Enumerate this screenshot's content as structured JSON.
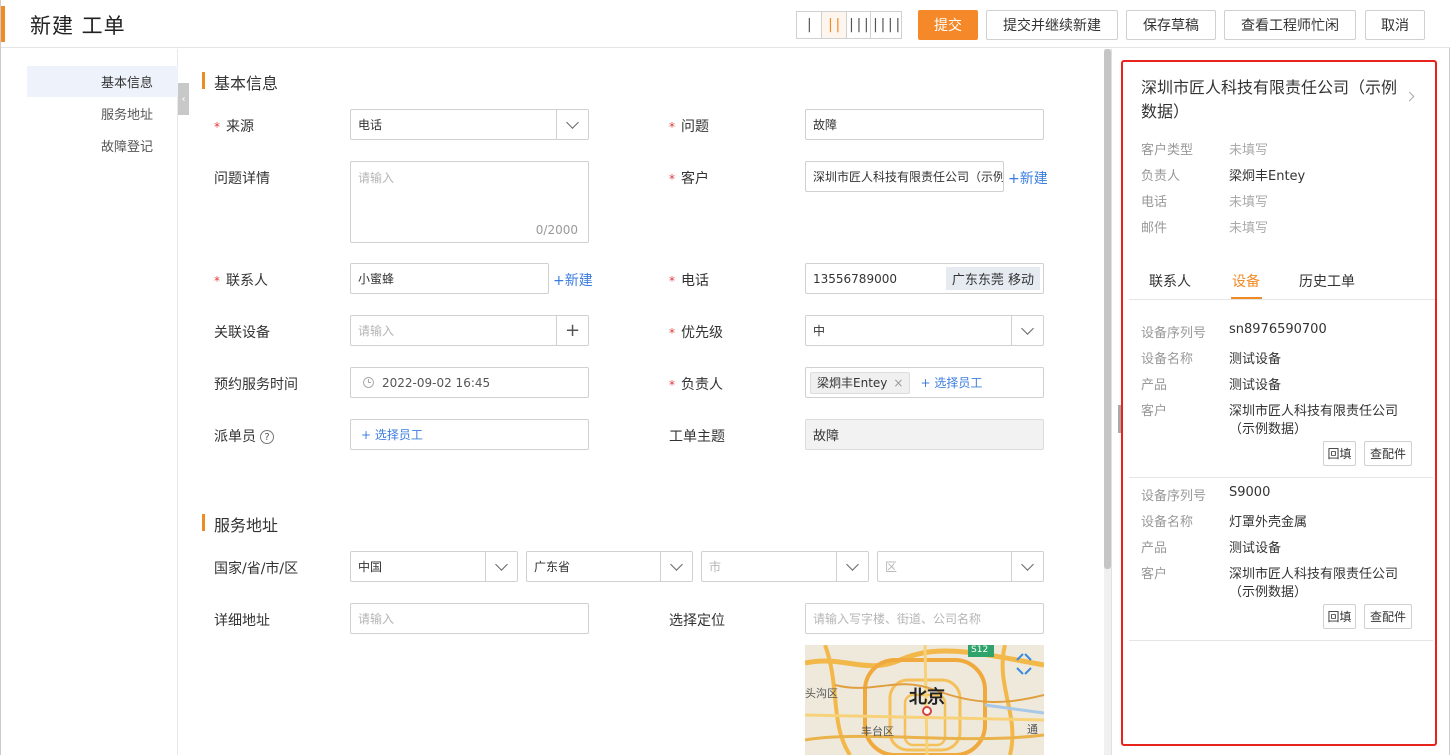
{
  "header": {
    "title": "新建 工单",
    "column_options": [
      "|",
      "||",
      "|||",
      "||||"
    ],
    "active_column": 1,
    "buttons": {
      "submit": "提交",
      "submit_continue": "提交并继续新建",
      "save_draft": "保存草稿",
      "engineer_busy": "查看工程师忙闲",
      "cancel": "取消"
    }
  },
  "sidenav": {
    "items": [
      {
        "label": "基本信息",
        "active": true
      },
      {
        "label": "服务地址",
        "active": false
      },
      {
        "label": "故障登记",
        "active": false
      }
    ]
  },
  "basic": {
    "section_title": "基本信息",
    "source": {
      "label": "来源",
      "value": "电话"
    },
    "problem": {
      "label": "问题",
      "value": "故障"
    },
    "problem_detail": {
      "label": "问题详情",
      "placeholder": "请输入",
      "counter": "0/2000"
    },
    "customer": {
      "label": "客户",
      "value": "深圳市匠人科技有限责任公司（示例数据）",
      "new_link": "+新建"
    },
    "contact": {
      "label": "联系人",
      "value": "小蜜蜂",
      "new_link": "+新建"
    },
    "phone": {
      "label": "电话",
      "value": "13556789000",
      "location_badge": "广东东莞 移动"
    },
    "device": {
      "label": "关联设备",
      "placeholder": "请输入",
      "add_symbol": "+"
    },
    "priority": {
      "label": "优先级",
      "value": "中"
    },
    "appointment": {
      "label": "预约服务时间",
      "value": "2022-09-02 16:45"
    },
    "owner": {
      "label": "负责人",
      "tag": "梁炯丰Entey",
      "tag_remove": "×",
      "select_link": "+ 选择员工"
    },
    "dispatcher": {
      "label": "派单员",
      "help": "?",
      "select_link": "+ 选择员工"
    },
    "subject": {
      "label": "工单主题",
      "value": "故障"
    }
  },
  "address": {
    "section_title": "服务地址",
    "region_label": "国家/省/市/区",
    "country": "中国",
    "province": "广东省",
    "city_placeholder": "市",
    "district_placeholder": "区",
    "detail_label": "详细地址",
    "detail_placeholder": "请输入",
    "locate_label": "选择定位",
    "locate_placeholder": "请输入写字楼、街道、公司名称",
    "map": {
      "city_label": "北京",
      "road_badge": "S12",
      "district_left": "头沟区",
      "district_bottom": "丰台区",
      "district_right": "通"
    }
  },
  "panel": {
    "customer_name": "深圳市匠人科技有限责任公司（示例数据）",
    "info": [
      {
        "key": "客户类型",
        "value": "未填写",
        "empty": true
      },
      {
        "key": "负责人",
        "value": "梁炯丰Entey",
        "empty": false
      },
      {
        "key": "电话",
        "value": "未填写",
        "empty": true
      },
      {
        "key": "邮件",
        "value": "未填写",
        "empty": true
      }
    ],
    "tabs": [
      "联系人",
      "设备",
      "历史工单"
    ],
    "active_tab": 1,
    "devices": [
      {
        "serial_label": "设备序列号",
        "serial": "sn8976590700",
        "name_label": "设备名称",
        "name": "测试设备",
        "product_label": "产品",
        "product": "测试设备",
        "customer_label": "客户",
        "customer_line1": "深圳市匠人科技有限责任公司",
        "customer_line2": "（示例数据）",
        "fill_btn": "回填",
        "parts_btn": "查配件"
      },
      {
        "serial_label": "设备序列号",
        "serial": "S9000",
        "name_label": "设备名称",
        "name": "灯罩外壳金属",
        "product_label": "产品",
        "product": "测试设备",
        "customer_label": "客户",
        "customer_line1": "深圳市匠人科技有限责任公司",
        "customer_line2": "（示例数据）",
        "fill_btn": "回填",
        "parts_btn": "查配件"
      }
    ]
  },
  "colors": {
    "accent": "#f08a24",
    "link": "#3a7de0",
    "required": "#e23b3b",
    "highlight_border": "#e8221c"
  }
}
